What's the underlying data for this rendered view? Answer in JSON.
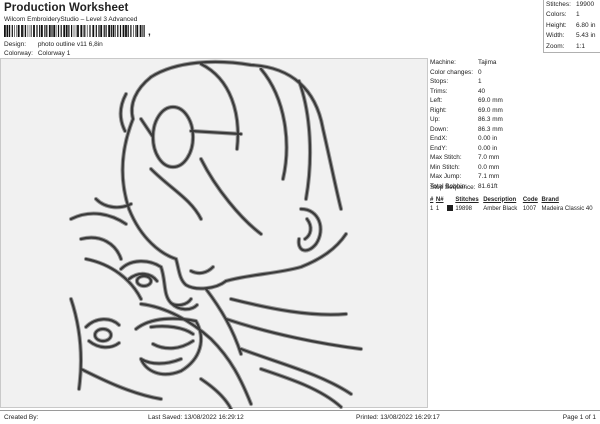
{
  "header": {
    "title": "Production Worksheet",
    "subtitle": "Wilcom EmbroideryStudio – Level 3 Advanced",
    "barcode_suffix": ","
  },
  "meta": [
    {
      "label": "Design:",
      "value": "photo outline v11 6,8in"
    },
    {
      "label": "Colorway:",
      "value": "Colorway 1"
    }
  ],
  "stats": [
    {
      "label": "Stitches:",
      "value": "19900"
    },
    {
      "label": "Colors:",
      "value": "1"
    },
    {
      "label": "Height:",
      "value": "6.80 in"
    },
    {
      "label": "Width:",
      "value": "5.43 in"
    },
    {
      "label": "Zoom:",
      "value": "1:1"
    }
  ],
  "machine_info": [
    {
      "label": "Machine:",
      "value": "Tajima"
    },
    {
      "label": "Color changes:",
      "value": "0"
    },
    {
      "label": "Stops:",
      "value": "1"
    },
    {
      "label": "Trims:",
      "value": "40"
    },
    {
      "label": "Left:",
      "value": "69.0 mm"
    },
    {
      "label": "Right:",
      "value": "69.0 mm"
    },
    {
      "label": "Up:",
      "value": "86.3 mm"
    },
    {
      "label": "Down:",
      "value": "86.3 mm"
    },
    {
      "label": "EndX:",
      "value": "0.00 in"
    },
    {
      "label": "EndY:",
      "value": "0.00 in"
    },
    {
      "label": "Max Stitch:",
      "value": "7.0 mm"
    },
    {
      "label": "Min Stitch:",
      "value": "0.0 mm"
    },
    {
      "label": "Max Jump:",
      "value": "7.1 mm"
    },
    {
      "label": "Total Bobbin:",
      "value": "81.61ft"
    }
  ],
  "stop_sequence": {
    "title": "Stop Sequence:",
    "headers": [
      "#",
      "N#",
      "",
      "Stitches",
      "Description",
      "Code",
      "Brand"
    ],
    "rows": [
      {
        "num": "1",
        "n": "1",
        "color": "#1f1f1f",
        "stitches": "19898",
        "description": "Amber Black",
        "code": "1007",
        "brand": "Madeira Classic 40"
      }
    ]
  },
  "design": {
    "stitch_color": "#3a3a3a",
    "outline_color": "#9a9a9a",
    "background": "#f1f1f1"
  },
  "footer": {
    "created_by": "Created By:",
    "last_saved": "Last Saved: 13/08/2022 16:29:12",
    "printed": "Printed: 13/08/2022 16:29:17",
    "page": "Page 1 of 1"
  }
}
